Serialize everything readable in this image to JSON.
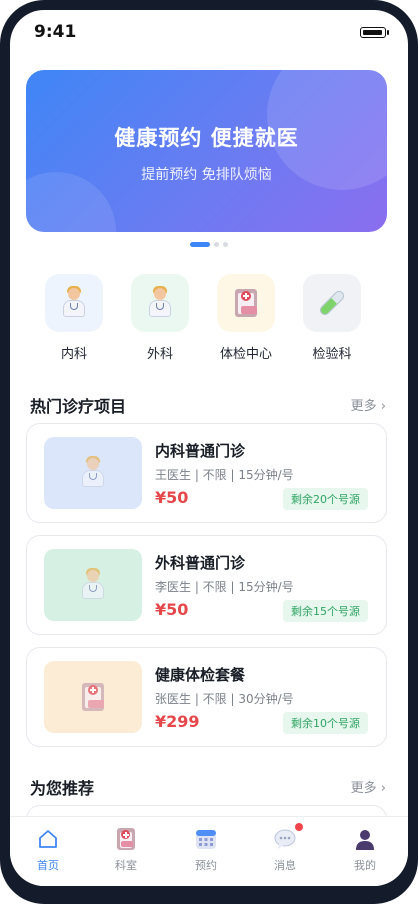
{
  "status_bar": {
    "time": "9:41",
    "battery_level": 0.85
  },
  "banner": {
    "title": "健康预约 便捷就医",
    "subtitle": "提前预约 免排队烦恼",
    "slides": 3,
    "active_slide": 1
  },
  "categories": [
    {
      "label": "内科",
      "icon": "doctor-icon",
      "tint": "#eef4fd"
    },
    {
      "label": "外科",
      "icon": "surgeon-icon",
      "tint": "#eaf8f1"
    },
    {
      "label": "体检中心",
      "icon": "clipboard-icon",
      "tint": "#fff7e6"
    },
    {
      "label": "检验科",
      "icon": "test-tube-icon",
      "tint": "#f0f2f5"
    }
  ],
  "popular": {
    "title": "热门诊疗项目",
    "more": "更多",
    "items": [
      {
        "name": "内科普通门诊",
        "meta": "王医生 | 不限 | 15分钟/号",
        "price": "¥50",
        "badge": "剩余20个号源",
        "thumb_color": "#dce6fb",
        "icon": "doctor-icon"
      },
      {
        "name": "外科普通门诊",
        "meta": "李医生 | 不限 | 15分钟/号",
        "price": "¥50",
        "badge": "剩余15个号源",
        "thumb_color": "#d6f1e4",
        "icon": "surgeon-icon"
      },
      {
        "name": "健康体检套餐",
        "meta": "张医生 | 不限 | 30分钟/号",
        "price": "¥299",
        "badge": "剩余10个号源",
        "thumb_color": "#fcebd5",
        "icon": "clipboard-icon"
      }
    ]
  },
  "recommend": {
    "title": "为您推荐",
    "more": "更多"
  },
  "tabbar": {
    "tabs": [
      {
        "label": "首页",
        "icon": "home-icon",
        "active": true
      },
      {
        "label": "科室",
        "icon": "clipboard-icon",
        "active": false
      },
      {
        "label": "预约",
        "icon": "calendar-icon",
        "active": false
      },
      {
        "label": "消息",
        "icon": "chat-bubble-icon",
        "active": false,
        "badge_dot": true
      },
      {
        "label": "我的",
        "icon": "user-icon",
        "active": false
      }
    ]
  },
  "colors": {
    "accent": "#3f86f6",
    "price": "#e5474b",
    "badge_text": "#2fa463",
    "badge_bg": "#e7f7ee"
  }
}
